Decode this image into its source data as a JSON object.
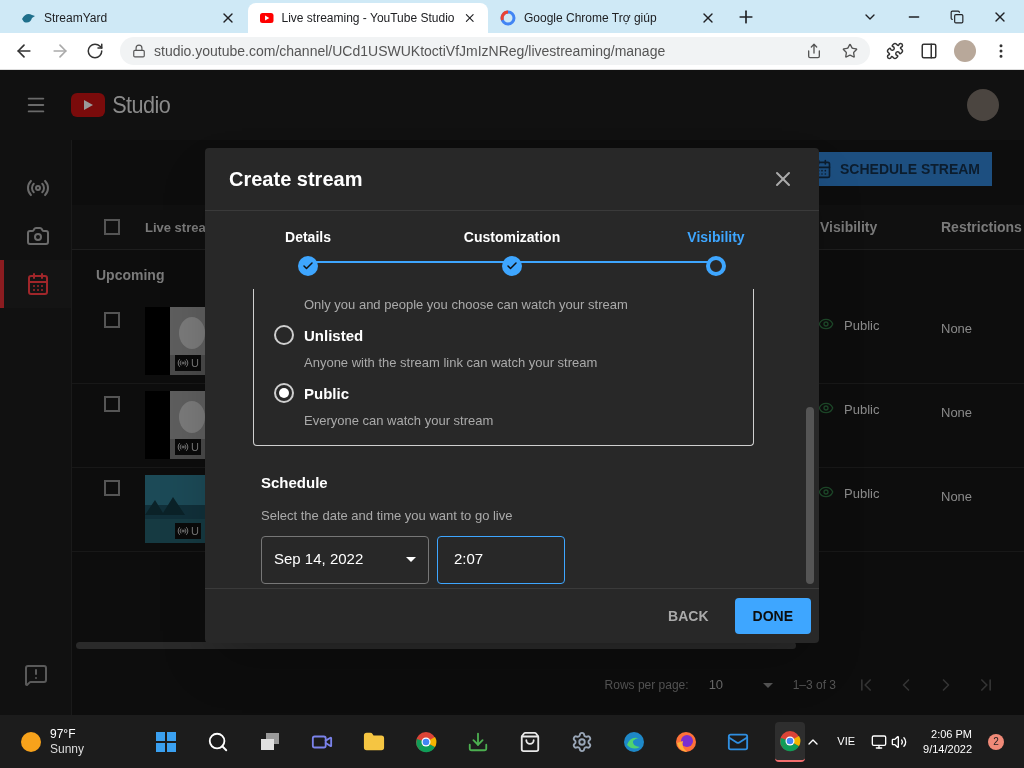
{
  "browser": {
    "tabs": [
      {
        "title": "StreamYard",
        "kind": "streamyard",
        "selected": false
      },
      {
        "title": "Live streaming - YouTube Studio",
        "kind": "youtube",
        "selected": true
      },
      {
        "title": "Google Chrome Trợ giúp",
        "kind": "google",
        "selected": false
      }
    ],
    "url": "studio.youtube.com/channel/UCd1USWUKtoctiVfJmIzNReg/livestreaming/manage"
  },
  "studio": {
    "logo": "Studio",
    "sidebar": [
      {
        "kind": "live",
        "selected": false
      },
      {
        "kind": "camera",
        "selected": false
      },
      {
        "kind": "calendar",
        "selected": true
      }
    ],
    "schedule_button": "SCHEDULE STREAM",
    "table": {
      "all_checked": false,
      "columns": [
        "Live strea",
        "Visibility",
        "Restrictions"
      ],
      "section": "Upcoming",
      "rows": [
        {
          "kind": "portrait",
          "checked": false,
          "badge": "U",
          "visibility": "Public",
          "restrictions": "None"
        },
        {
          "kind": "portrait",
          "checked": false,
          "badge": "U",
          "visibility": "Public",
          "restrictions": "None"
        },
        {
          "kind": "landscape",
          "checked": false,
          "badge": "U",
          "visibility": "Public",
          "restrictions": "None"
        }
      ]
    },
    "pagination": {
      "label": "Rows per page:",
      "value": "10",
      "range": "1–3 of 3"
    }
  },
  "dialog": {
    "title": "Create stream",
    "steps": [
      {
        "label": "Details",
        "completed": true,
        "selected": false
      },
      {
        "label": "Customization",
        "completed": true,
        "selected": false
      },
      {
        "label": "Visibility",
        "completed": false,
        "selected": true
      }
    ],
    "options": [
      {
        "description": "Only you and people you choose can watch your stream"
      },
      {
        "label": "Unlisted",
        "description": "Anyone with the stream link can watch your stream",
        "selected": false
      },
      {
        "label": "Public",
        "description": "Everyone can watch your stream",
        "selected": true
      }
    ],
    "schedule": {
      "title": "Schedule",
      "hint": "Select the date and time you want to go live",
      "date": "Sep 14, 2022",
      "time": "2:07",
      "time_focused": true
    },
    "buttons": [
      {
        "label": "BACK",
        "kind": "text"
      },
      {
        "label": "DONE",
        "kind": "primary"
      }
    ]
  },
  "taskbar": {
    "weather": {
      "temp": "97°F",
      "condition": "Sunny"
    },
    "apps": [
      {
        "kind": "start",
        "active": false
      },
      {
        "kind": "search",
        "active": false
      },
      {
        "kind": "taskview",
        "active": false
      },
      {
        "kind": "chat",
        "active": false
      },
      {
        "kind": "folder",
        "active": false
      },
      {
        "kind": "chrome",
        "active": false
      },
      {
        "kind": "download",
        "active": false
      },
      {
        "kind": "store",
        "active": false
      },
      {
        "kind": "settings",
        "active": false
      },
      {
        "kind": "edge",
        "active": false
      },
      {
        "kind": "firefox",
        "active": false
      },
      {
        "kind": "mail",
        "active": false
      },
      {
        "kind": "chrome",
        "active": true
      }
    ],
    "language": "VIE",
    "time": "2:06 PM",
    "date": "9/14/2022",
    "notifications": "2"
  }
}
